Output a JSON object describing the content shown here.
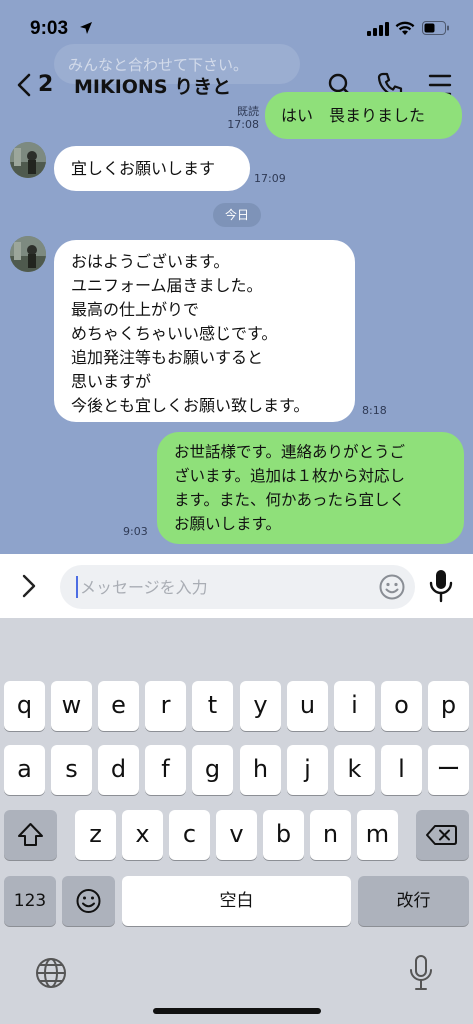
{
  "status_bar": {
    "time": "9:03"
  },
  "header": {
    "back_count": "2",
    "title": "MIKIONS りきと"
  },
  "messages": {
    "ghost_text": "みんなと合わせて下さい。",
    "prev_out": {
      "text": "はい　畏まりました",
      "read": "既読",
      "time": "17:08"
    },
    "msg1": {
      "text": "宜しくお願いします",
      "time": "17:09"
    },
    "date_label": "今日",
    "msg2": {
      "lines": [
        "おはようございます。",
        "ユニフォーム届きました。",
        "最高の仕上がりで",
        "めちゃくちゃいい感じです。",
        "追加発注等もお願いすると",
        "思いますが",
        "今後とも宜しくお願い致します。"
      ],
      "time": "8:18"
    },
    "msg3": {
      "lines": [
        "お世話様です。連絡ありがとうご",
        "ざいます。追加は１枚から対応し",
        "ます。また、何かあったら宜しく",
        "お願いします。"
      ],
      "time": "9:03"
    }
  },
  "input": {
    "placeholder": "メッセージを入力",
    "value": ""
  },
  "keyboard": {
    "row1": [
      "q",
      "w",
      "e",
      "r",
      "t",
      "y",
      "u",
      "i",
      "o",
      "p"
    ],
    "row2": [
      "a",
      "s",
      "d",
      "f",
      "g",
      "h",
      "j",
      "k",
      "l",
      "ー"
    ],
    "row3": [
      "z",
      "x",
      "c",
      "v",
      "b",
      "n",
      "m"
    ],
    "num_label": "123",
    "space_label": "空白",
    "return_label": "改行"
  },
  "icons": [
    "location-arrow-icon",
    "signal-icon",
    "wifi-icon",
    "battery-icon",
    "back-chevron-icon",
    "search-icon",
    "phone-icon",
    "menu-icon",
    "expand-chevron-icon",
    "emoji-icon",
    "mic-icon",
    "shift-icon",
    "backspace-icon",
    "keyboard-emoji-icon",
    "globe-icon",
    "dictation-mic-icon"
  ],
  "colors": {
    "chat_bg": "#8ea3cb",
    "outgoing_bubble": "#8fe07a",
    "incoming_bubble": "#ffffff",
    "caret": "#4d6de3"
  }
}
